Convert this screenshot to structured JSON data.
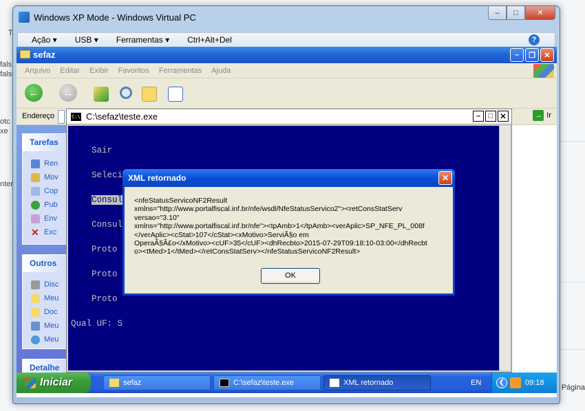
{
  "host": {
    "left_fragments": [
      "T",
      "fals",
      "falso",
      "otc",
      "xe",
      "nter"
    ],
    "right_fragment": "Página"
  },
  "vpc": {
    "title": "Windows XP Mode - Windows Virtual PC",
    "menu": [
      "Ação ▾",
      "USB ▾",
      "Ferramentas ▾",
      "Ctrl+Alt+Del"
    ],
    "help_glyph": "?"
  },
  "explorer": {
    "title": "sefaz",
    "menu": [
      "Arquivo",
      "Editar",
      "Exibir",
      "Favoritos",
      "Ferramentas",
      "Ajuda"
    ],
    "address_label": "Endereço",
    "go_label": "Ir",
    "tasks": {
      "header1": "Tarefas",
      "items1": [
        "Ren",
        "Mov",
        "Cop",
        "Pub",
        "Env",
        "Exc"
      ],
      "header2": "Outros",
      "items2": [
        "Disc",
        "Meu",
        "Doc",
        "Meu",
        "Meu"
      ],
      "header3": "Detalhe"
    }
  },
  "console": {
    "title": "C:\\sefaz\\teste.exe",
    "lines": [
      "    Sair",
      "    Seleciona certificado",
      "    Consulta Status NFE",
      "    Consulta Cadastro",
      "    Proto",
      "    Proto",
      "    Proto",
      "Qual UF: S"
    ]
  },
  "dialog": {
    "title": "XML retornado",
    "message": "<nfeStatusServicoNF2Result\nxmlns=\"http://www.portalfiscal.inf.br/nfe/wsdl/NfeStatusServico2\"><retConsStatServ\nversao=\"3.10\"\nxmlns=\"http://www.portalfiscal.inf.br/nfe\"><tpAmb>1</tpAmb><verAplic>SP_NFE_PL_008f\n</verAplic><cStat>107</cStat><xMotivo>ServiÃ§o em\nOperaÃ§Ã£o</xMotivo><cUF>35</cUF><dhRecbto>2015-07-29T09:18:10-03:00</dhRecbt\no><tMed>1</tMed></retConsStatServ></nfeStatusServicoNF2Result>",
    "ok_label": "OK"
  },
  "taskbar": {
    "start_label": "Iniciar",
    "tasks": [
      "sefaz",
      "C:\\sefaz\\teste.exe",
      "XML retornado"
    ],
    "lang": "EN",
    "clock": "09:18"
  }
}
